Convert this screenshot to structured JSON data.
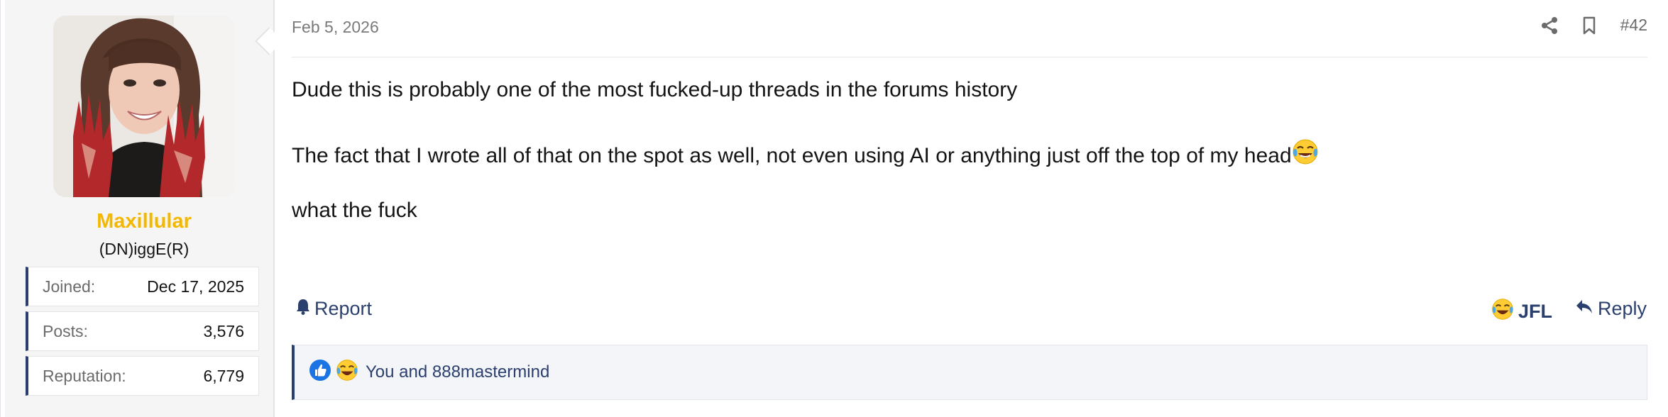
{
  "user": {
    "name": "Maxillular",
    "title": "(DN)iggE(R)",
    "name_color": "#f5b800",
    "stats": [
      {
        "label": "Joined:",
        "value": "Dec 17, 2025"
      },
      {
        "label": "Posts:",
        "value": "3,576"
      },
      {
        "label": "Reputation:",
        "value": "6,779"
      }
    ]
  },
  "post": {
    "date": "Feb 5, 2026",
    "number": "#42",
    "lines": [
      "Dude this is probably one of the most fucked-up threads in the forums history",
      "The fact that I wrote all of that on the spot as well, not even using AI or anything just off the top of my head",
      "what the fuck"
    ],
    "line2_trailing_icon": "joy-emoji-icon"
  },
  "actions": {
    "report_label": "Report",
    "reaction_label": "JFL",
    "reply_label": "Reply"
  },
  "reactions": {
    "icons": [
      "like-icon",
      "joy-emoji-icon"
    ],
    "text": "You and 888mastermind"
  },
  "colors": {
    "accent": "#2b3f6e",
    "sidebar_bg": "#f5f5f5",
    "reactions_bg": "#f3f5f8"
  }
}
